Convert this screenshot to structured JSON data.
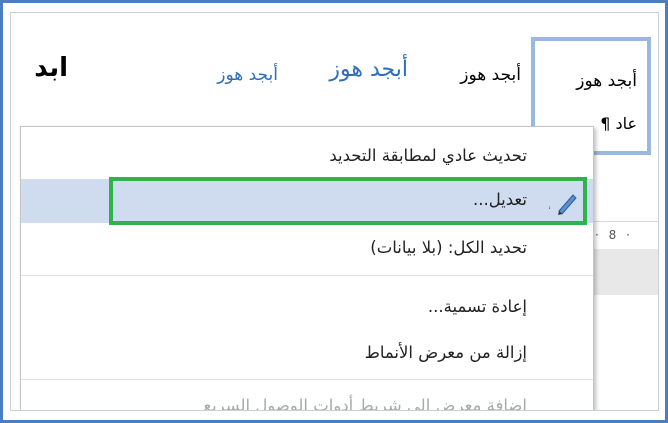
{
  "gallery": {
    "styles": [
      {
        "text": "أبجد هوز",
        "note": "selected normal style"
      },
      {
        "text": "أبجد هوز"
      },
      {
        "text": "أبجد هوز"
      },
      {
        "text": "أبجد هوز"
      },
      {
        "text": "ابد"
      }
    ],
    "selected_sub": "¶ عاد"
  },
  "menu": {
    "items": [
      {
        "label": "تحديث عادي لمطابقة التحديد",
        "state": "normal"
      },
      {
        "label": "تعديل...",
        "state": "hover"
      },
      {
        "label": "تحديد الكل: (بلا بيانات)",
        "state": "normal"
      },
      {
        "label": "إعادة تسمية...",
        "state": "normal"
      },
      {
        "label": "إزالة من معرض الأنماط",
        "state": "normal"
      },
      {
        "label": "إضافة معرض إلى شريط أدوات الوصول السريع",
        "state": "disabled"
      }
    ]
  },
  "ruler": {
    "marks": "· 8 ·"
  },
  "colors": {
    "frame": "#4a7ec0",
    "highlight_box": "#2db34a",
    "hover": "#cfdbee",
    "heading_blue": "#2e6fbd"
  }
}
